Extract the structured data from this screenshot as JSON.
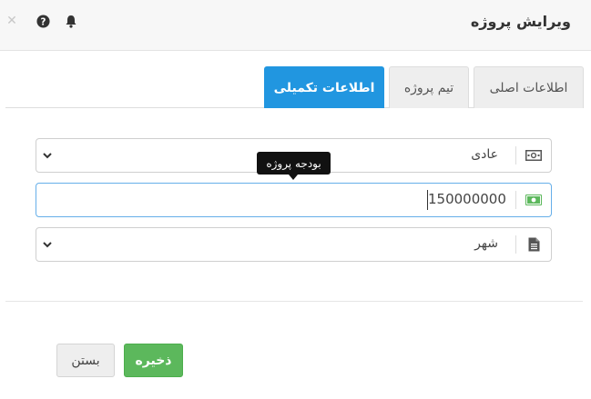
{
  "dialog": {
    "title": "ویرایش پروژه",
    "header_icons": [
      "close-icon",
      "help-icon",
      "bell-icon"
    ]
  },
  "tabs": [
    {
      "label": "اطلاعات اصلی",
      "active": false
    },
    {
      "label": "تیم پروژه",
      "active": false
    },
    {
      "label": "اطلاعات تکمیلی",
      "active": true
    }
  ],
  "fields": {
    "priority": {
      "value": "عادی",
      "icon": "money-icon"
    },
    "budget": {
      "value": "150000000",
      "icon": "money-icon",
      "tooltip": "بودجه پروژه"
    },
    "city": {
      "value": "شهر",
      "icon": "document-icon"
    }
  },
  "buttons": {
    "save": "ذخیره",
    "close": "بستن"
  },
  "colors": {
    "active_tab": "#2196e0",
    "save_button": "#5cb85c",
    "money_icon": "#5cb85c"
  }
}
